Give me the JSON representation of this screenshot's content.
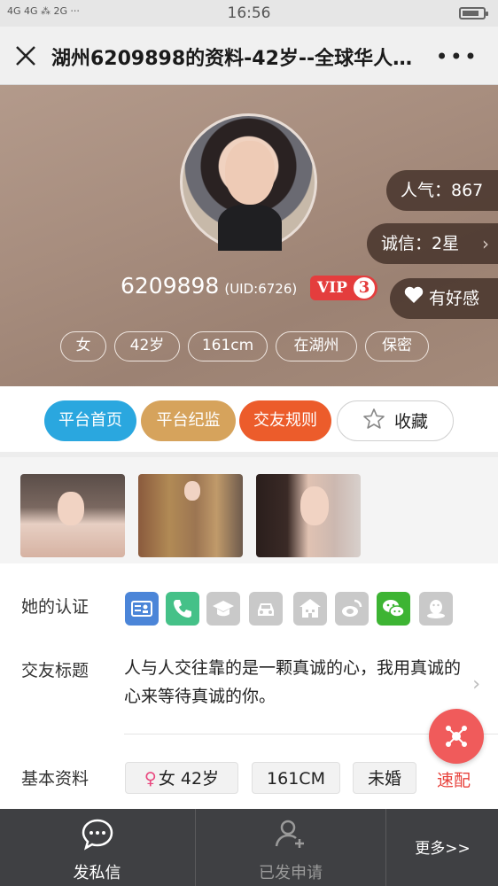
{
  "status_bar": {
    "signal": "4G 4G ⁂ 2G ⋅⋅⋅",
    "time": "16:56"
  },
  "title_bar": {
    "title": "湖州6209898的资料-42岁--全球华人…",
    "more": "•••"
  },
  "profile": {
    "name": "6209898",
    "uid": "(UID:6726)",
    "vip_label": "VIP",
    "vip_level": "3",
    "popularity": "人气：867",
    "credit": "诚信：2星",
    "like": "有好感",
    "tags": [
      "女",
      "42岁",
      "161cm",
      "在湖州",
      "保密"
    ]
  },
  "actions": {
    "home": "平台首页",
    "supervision": "平台纪监",
    "rules": "交友规则",
    "favorite": "收藏"
  },
  "info": {
    "cert_label": "她的认证",
    "motto_label": "交友标题",
    "motto_text": "人与人交往靠的是一颗真诚的心，我用真诚的心来等待真诚的你。",
    "basic_label": "基本资料",
    "basic": {
      "gender_symbol": "♀",
      "gender_age": "女 42岁",
      "height": "161CM",
      "marital": "未婚"
    },
    "certifications": [
      "id-card-icon",
      "phone-icon",
      "education-icon",
      "car-icon",
      "house-icon",
      "weibo-icon",
      "wechat-icon",
      "qq-icon"
    ]
  },
  "fab": {
    "label": "速配"
  },
  "bottom_bar": {
    "message": "发私信",
    "request": "已发申请",
    "more": "更多>>"
  },
  "colors": {
    "blue": "#2aa7df",
    "gold": "#d6a35c",
    "orange": "#ec5c2b",
    "vip_red": "#e43d3d",
    "wechat_green": "#3db433"
  }
}
